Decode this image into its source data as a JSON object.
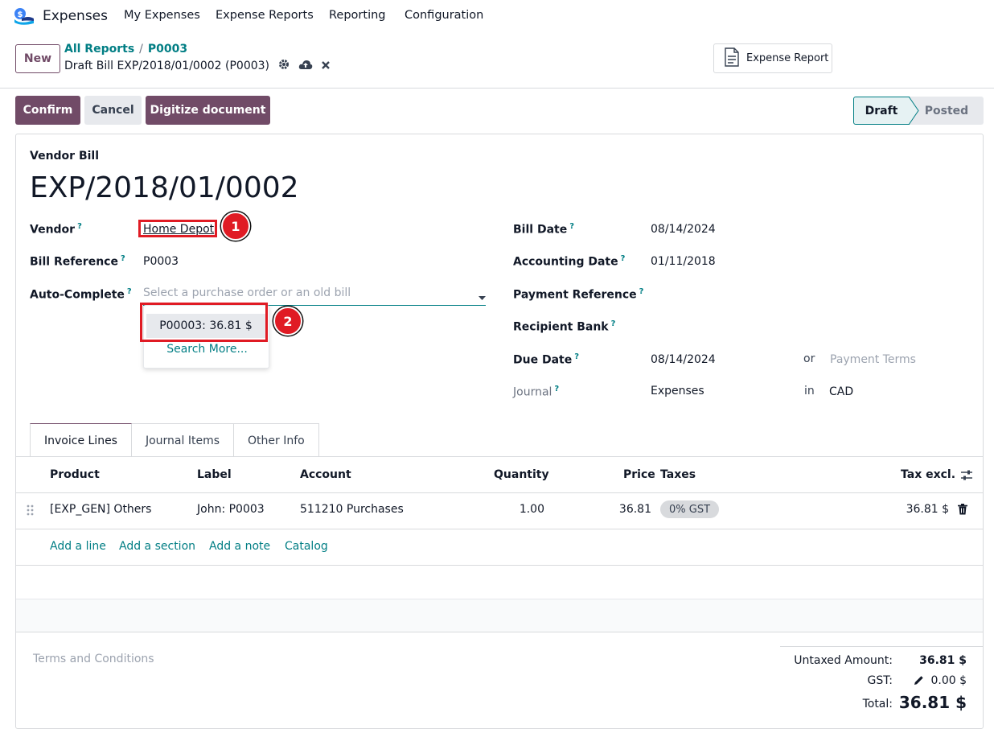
{
  "navbar": {
    "app_name": "Expenses",
    "menu": [
      "My Expenses",
      "Expense Reports",
      "Reporting",
      "Configuration"
    ]
  },
  "control_panel": {
    "new_label": "New",
    "breadcrumb_parent": "All Reports",
    "breadcrumb_sep": "/",
    "breadcrumb_current": "P0003",
    "record_title": "Draft Bill EXP/2018/01/0002 (P0003)",
    "report_button": "Expense Report"
  },
  "actions": {
    "confirm": "Confirm",
    "cancel": "Cancel",
    "digitize": "Digitize document"
  },
  "status": {
    "draft": "Draft",
    "posted": "Posted"
  },
  "form": {
    "doc_type": "Vendor Bill",
    "number": "EXP/2018/01/0002",
    "help": "?",
    "vendor_label": "Vendor",
    "vendor": "Home Depot",
    "bill_ref_label": "Bill Reference",
    "bill_ref": "P0003",
    "autocomplete_label": "Auto-Complete",
    "autocomplete_placeholder": "Select a purchase order or an old bill",
    "bill_date_label": "Bill Date",
    "bill_date": "08/14/2024",
    "acc_date_label": "Accounting Date",
    "acc_date": "01/11/2018",
    "pay_ref_label": "Payment Reference",
    "recipient_bank_label": "Recipient Bank",
    "due_date_label": "Due Date",
    "due_date": "08/14/2024",
    "or": "or",
    "payment_terms_placeholder": "Payment Terms",
    "journal_label": "Journal",
    "journal": "Expenses",
    "in": "in",
    "currency": "CAD"
  },
  "dropdown": {
    "option": "P00003: 36.81 $",
    "search_more": "Search More..."
  },
  "tabs": [
    "Invoice Lines",
    "Journal Items",
    "Other Info"
  ],
  "table": {
    "headers": {
      "product": "Product",
      "label": "Label",
      "account": "Account",
      "quantity": "Quantity",
      "price": "Price",
      "taxes": "Taxes",
      "tax_excl": "Tax excl."
    },
    "rows": [
      {
        "product": "[EXP_GEN] Others",
        "label": "John: P0003",
        "account": "511210 Purchases",
        "quantity": "1.00",
        "price": "36.81",
        "taxes": "0% GST",
        "subtotal": "36.81 $"
      }
    ],
    "add_links": [
      "Add a line",
      "Add a section",
      "Add a note",
      "Catalog"
    ]
  },
  "terms_placeholder": "Terms and Conditions",
  "totals": {
    "untaxed_label": "Untaxed Amount:",
    "untaxed": "36.81 $",
    "gst_label": "GST:",
    "gst": "0.00 $",
    "total_label": "Total:",
    "total": "36.81 $"
  },
  "markers": [
    "1",
    "2"
  ],
  "colors": {
    "brand": "#714b67",
    "link": "#017e84",
    "highlight": "#e01b24"
  }
}
